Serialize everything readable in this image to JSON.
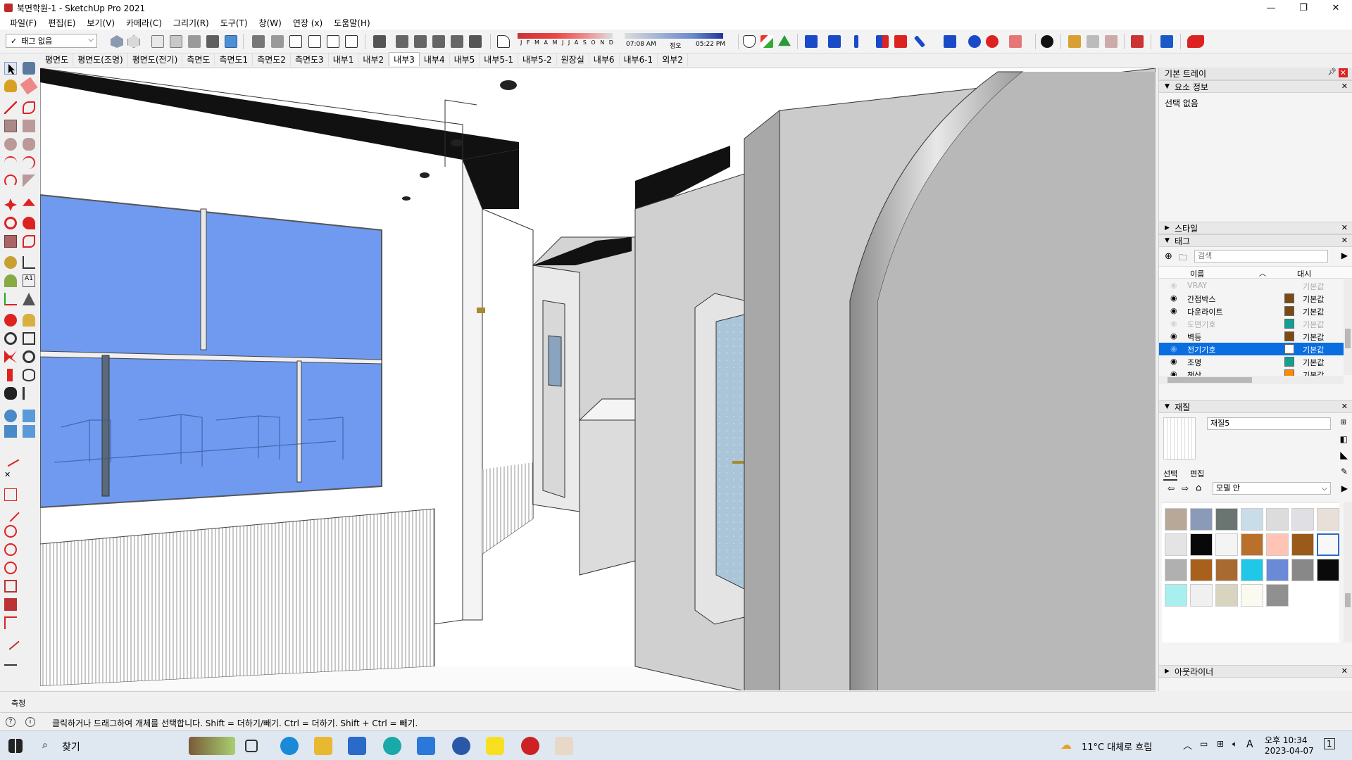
{
  "window": {
    "title": "북면학원-1 - SketchUp Pro 2021",
    "min": "—",
    "max": "❐",
    "close": "✕"
  },
  "menu": [
    "파일(F)",
    "편집(E)",
    "보기(V)",
    "카메라(C)",
    "그리기(R)",
    "도구(T)",
    "창(W)",
    "연장 (x)",
    "도움말(H)"
  ],
  "toolbar": {
    "tag_select": "태그 없음",
    "shadow": {
      "months": "J F M A M J J A S O N D",
      "time_start": "07:08 AM",
      "noon": "정오",
      "time_end": "05:22 PM"
    }
  },
  "scene_tabs": [
    "평면도",
    "평면도(조명)",
    "평면도(전기)",
    "측면도",
    "측면도1",
    "측면도2",
    "측면도3",
    "내부1",
    "내부2",
    "내부3",
    "내부4",
    "내부5",
    "내부5-1",
    "내부5-2",
    "원장실",
    "내부6",
    "내부6-1",
    "외부2"
  ],
  "active_scene": "내부3",
  "tray": {
    "title": "기본 트레이",
    "entity_info": {
      "title": "요소 정보",
      "value": "선택 없음"
    },
    "styles": {
      "title": "스타일"
    },
    "tags": {
      "title": "태그",
      "search_placeholder": "검색",
      "col_name": "이름",
      "col_dash": "대시",
      "rows": [
        {
          "name": "VRAY",
          "color": "",
          "dash": "기본값",
          "visible": false,
          "dim": true,
          "selected": false
        },
        {
          "name": "간접박스",
          "color": "#7a4a12",
          "dash": "기본값",
          "visible": true,
          "dim": false,
          "selected": false
        },
        {
          "name": "다운라이트",
          "color": "#7a4a12",
          "dash": "기본값",
          "visible": true,
          "dim": false,
          "selected": false
        },
        {
          "name": "도면기호",
          "color": "#12a090",
          "dash": "기본값",
          "visible": false,
          "dim": true,
          "selected": false
        },
        {
          "name": "벽등",
          "color": "#7a4a12",
          "dash": "기본값",
          "visible": true,
          "dim": false,
          "selected": false
        },
        {
          "name": "전기기호",
          "color": "#ffffff",
          "dash": "기본값",
          "visible": false,
          "dim": false,
          "selected": true
        },
        {
          "name": "조명",
          "color": "#12a090",
          "dash": "기본값",
          "visible": true,
          "dim": false,
          "selected": false
        },
        {
          "name": "책상",
          "color": "#ff8800",
          "dash": "기본값",
          "visible": true,
          "dim": false,
          "selected": false
        }
      ]
    },
    "materials": {
      "title": "재질",
      "name_value": "재질5",
      "tab_select": "선택",
      "tab_edit": "편집",
      "library": "모델 안",
      "swatches": [
        "#b8a898",
        "#8a9ab8",
        "#6a7470",
        "#c8dde8",
        "#dcdcdc",
        "#e0e0e4",
        "#e8e0d8",
        "#e4e4e4",
        "#080808",
        "#f4f4f4",
        "#b8702a",
        "#ffc4b4",
        "#9a5a1a",
        "#f8f8f8",
        "#b0b0b0",
        "#a8601c",
        "#a86a30",
        "#20c8e8",
        "#6a8ad8",
        "#888888",
        "#0a0a0a",
        "#a8f0f0",
        "#f0f0f0",
        "#d8d4c0",
        "#fafaf0",
        "#909090"
      ]
    },
    "outliner": {
      "title": "아웃라이너"
    }
  },
  "measure_label": "측정",
  "status_message": "클릭하거나 드래그하여 개체를 선택합니다. Shift = 더하기/빼기. Ctrl = 더하기. Shift + Ctrl = 빼기.",
  "taskbar": {
    "search": "찾기",
    "weather": "11°C 대체로 흐림",
    "time": "오후 10:34",
    "date": "2023-04-07",
    "ime": "A",
    "notify_count": "1"
  }
}
